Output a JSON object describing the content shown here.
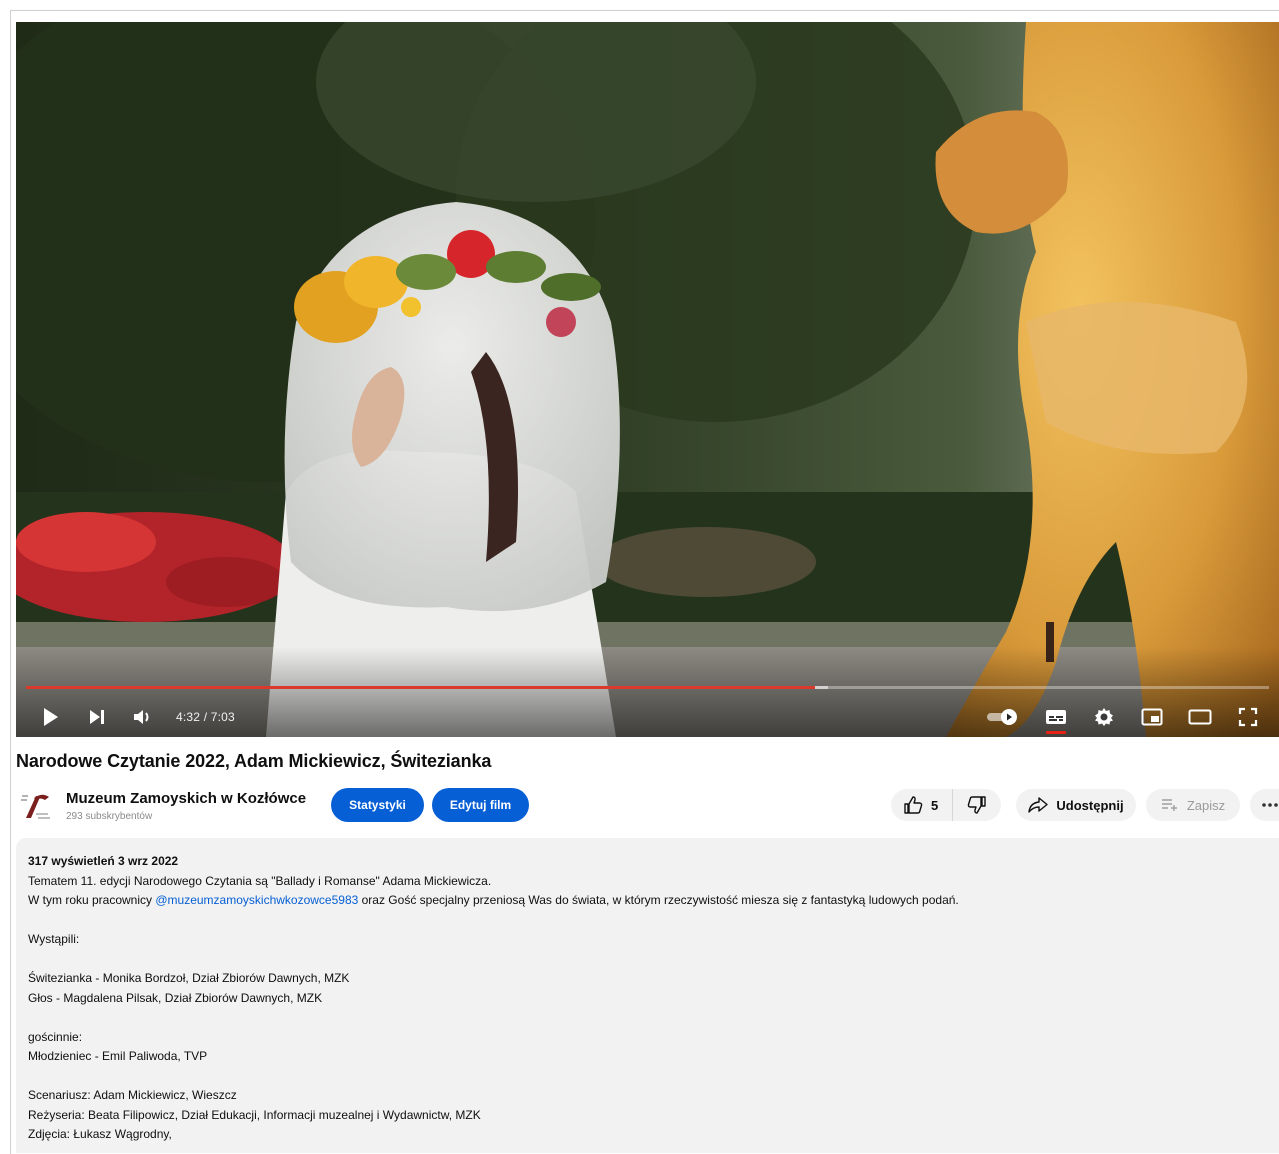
{
  "player": {
    "time_display": "4:32 / 7:03",
    "progress_played": 0.635,
    "progress_buffered": 0.645
  },
  "video": {
    "title": "Narodowe Czytanie 2022, Adam Mickiewicz, Świtezianka"
  },
  "channel": {
    "name": "Muzeum Zamoyskich w Kozłówce",
    "subscribers": "293 subskrybentów"
  },
  "actions": {
    "stats_label": "Statystyki",
    "edit_label": "Edytuj film",
    "like_count": "5",
    "share_label": "Udostępnij",
    "save_label": "Zapisz"
  },
  "description": {
    "views_date": "317 wyświetleń  3 wrz 2022",
    "line1": "Tematem 11. edycji Narodowego Czytania są \"Ballady i Romanse\" Adama Mickiewicza.",
    "line2_prefix": "W tym roku pracownicy ",
    "line2_mention": "@muzeumzamoyskichwkozowce5983",
    "line2_suffix": " oraz Gość specjalny przeniosą Was do świata, w którym rzeczywistość miesza się z fantastyką ludowych podań.",
    "performers_heading": "Wystąpili:",
    "performer1": "Świtezianka - Monika Bordzoł, Dział Zbiorów Dawnych, MZK",
    "performer2": "Głos - Magdalena Pilsak, Dział Zbiorów Dawnych, MZK",
    "guest_heading": "gościnnie:",
    "guest1": "Młodzieniec - Emil Paliwoda, TVP",
    "credit1": "Scenariusz: Adam Mickiewicz, Wieszcz",
    "credit2": "Reżyseria: Beata Filipowicz, Dział Edukacji, Informacji muzealnej i Wydawnictw, MZK",
    "credit3": "Zdjęcia: Łukasz Wągrodny,"
  },
  "colors": {
    "accent_blue": "#065fd4",
    "progress_red": "#d93a2b"
  },
  "icons": {
    "play": "play-icon",
    "next": "next-icon",
    "volume": "volume-icon",
    "autoplay": "autoplay-toggle-icon",
    "subtitles": "subtitles-icon",
    "settings": "gear-icon",
    "miniplayer": "miniplayer-icon",
    "theater": "theater-mode-icon",
    "fullscreen": "fullscreen-icon",
    "like": "thumbs-up-icon",
    "dislike": "thumbs-down-icon",
    "share": "share-icon",
    "save": "save-playlist-icon",
    "more": "more-icon"
  }
}
